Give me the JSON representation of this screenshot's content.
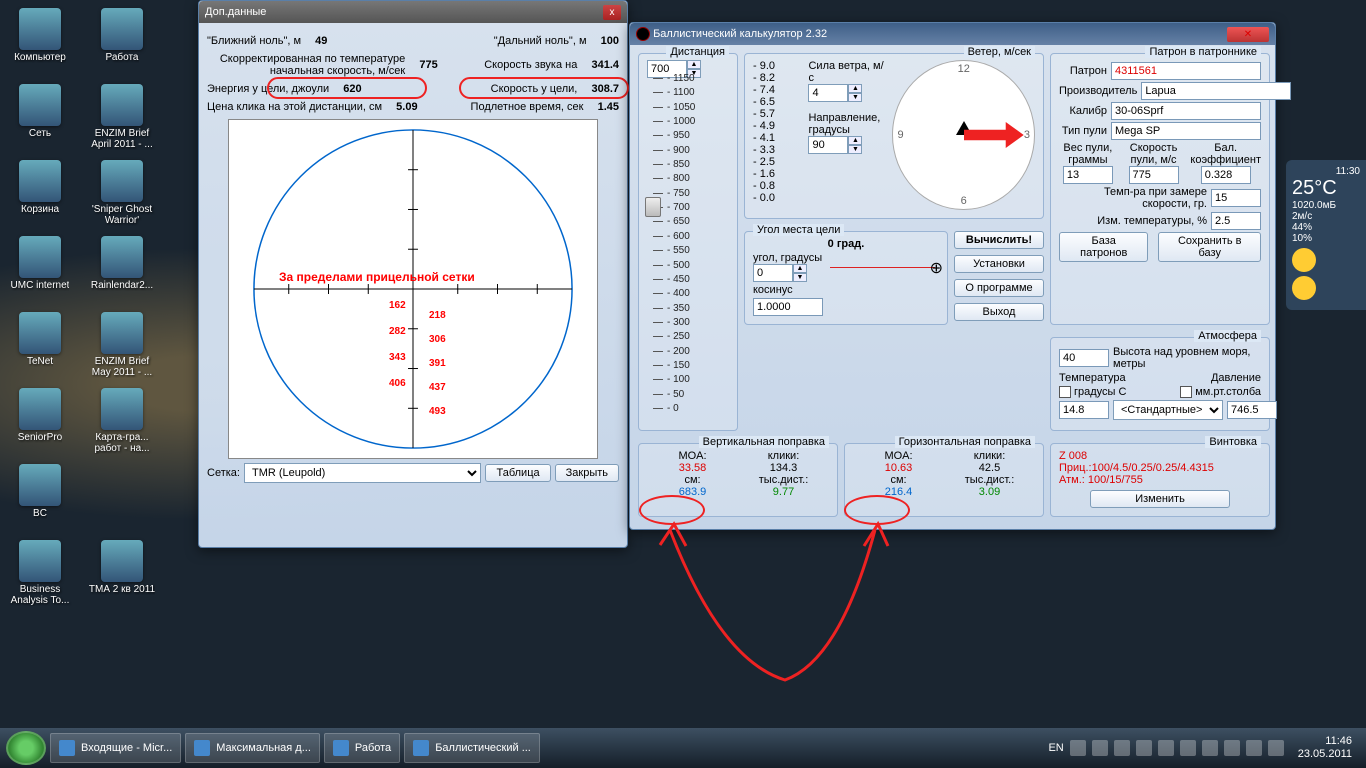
{
  "desktop_icons": [
    [
      "Компьютер",
      "Работа"
    ],
    [
      "Сеть",
      "ENZIM Brief April 2011 - ..."
    ],
    [
      "Корзина",
      "'Sniper Ghost Warrior'"
    ],
    [
      "UMC internet",
      "Rainlendar2..."
    ],
    [
      "TeNet",
      "ENZIM Brief May 2011 - ..."
    ],
    [
      "SeniorPro",
      "Карта-гра... работ - на..."
    ],
    [
      "BC",
      ""
    ],
    [
      "Business Analysis To...",
      "ТМА 2 кв 2011"
    ]
  ],
  "win1": {
    "title": "Доп.данные",
    "near_zero_lbl": "\"Ближний ноль\", м",
    "near_zero_val": "49",
    "far_zero_lbl": "\"Дальний ноль\", м",
    "far_zero_val": "100",
    "v_corr_lbl": "Скорректированная по температуре начальная скорость, м/сек",
    "v_corr_val": "775",
    "sound_lbl": "Скорость звука на",
    "sound_val": "341.4",
    "energy_lbl": "Энергия у цели, джоули",
    "energy_val": "620",
    "v_target_lbl": "Скорость у цели,",
    "v_target_val": "308.7",
    "click_lbl": "Цена клика на этой дистанции, см",
    "click_val": "5.09",
    "tof_lbl": "Подлетное время, сек",
    "tof_val": "1.45",
    "scope_warn": "За пределами прицельной сетки",
    "scope_nums_left": [
      "162",
      "282",
      "343",
      "406"
    ],
    "scope_nums_right": [
      "218",
      "306",
      "391",
      "437",
      "493"
    ],
    "grid_lbl": "Сетка:",
    "grid_val": "TMR (Leupold)",
    "btn_table": "Таблица",
    "btn_close": "Закрыть"
  },
  "win2": {
    "title": "Баллистический калькулятор 2.32",
    "group_dist": "Дистанция",
    "dist_val": "700",
    "dist_ticks": [
      "1150",
      "1100",
      "1050",
      "1000",
      "950",
      "900",
      "850",
      "800",
      "750",
      "700",
      "650",
      "600",
      "550",
      "500",
      "450",
      "400",
      "350",
      "300",
      "250",
      "200",
      "150",
      "100",
      "50",
      "0"
    ],
    "group_wind": "Ветер, м/сек",
    "wind_force_lbl": "Сила ветра, м/с",
    "wind_force_val": "4",
    "wind_dir_lbl": "Направление, градусы",
    "wind_dir_val": "90",
    "wind_ticks": [
      "9.0",
      "8.2",
      "7.4",
      "6.5",
      "5.7",
      "4.9",
      "4.1",
      "3.3",
      "2.5",
      "1.6",
      "0.8",
      "0.0"
    ],
    "compass": [
      "12",
      "3",
      "6",
      "9"
    ],
    "group_angle": "Угол места цели",
    "angle_txt": "0 град.",
    "angle_lbl": "угол, градусы",
    "angle_val": "0",
    "cos_lbl": "косинус",
    "cos_val": "1.0000",
    "btn_calc": "Вычислить!",
    "btn_settings": "Установки",
    "btn_about": "О программе",
    "btn_exit": "Выход",
    "group_cart": "Патрон в патроннике",
    "cart_patron_lbl": "Патрон",
    "cart_patron_val": "4311561",
    "cart_maker_lbl": "Производитель",
    "cart_maker_val": "Lapua",
    "cart_cal_lbl": "Калибр",
    "cart_cal_val": "30-06Sprf",
    "cart_type_lbl": "Тип пули",
    "cart_type_val": "Mega SP",
    "bw_lbl": "Вес пули, граммы",
    "bw_val": "13",
    "bv_lbl": "Скорость пули, м/с",
    "bv_val": "775",
    "bc_lbl": "Бал. коэффициент",
    "bc_val": "0.328",
    "tmeas_lbl": "Темп-ра при замере скорости, гр.",
    "tmeas_val": "15",
    "tdelta_lbl": "Изм. температуры, %",
    "tdelta_val": "2.5",
    "btn_db": "База патронов",
    "btn_save": "Сохранить в базу",
    "group_atm": "Атмосфера",
    "alt_val": "40",
    "alt_lbl": "Высота над уровнем моря, метры",
    "temp_hdr": "Температура",
    "press_hdr": "Давление",
    "temp_chk": "градусы С",
    "press_chk": "мм.рт.столба",
    "temp_val": "14.8",
    "std_val": "<Стандартные>",
    "press_val": "746.5",
    "group_vert": "Вертикальная поправка",
    "group_horz": "Горизонтальная поправка",
    "moa_lbl": "MOA:",
    "clicks_lbl": "клики:",
    "cm_lbl": "см:",
    "mil_lbl": "тыс.дист.:",
    "v_moa": "33.58",
    "v_click": "134.3",
    "v_cm": "683.9",
    "v_mil": "9.77",
    "h_moa": "10.63",
    "h_click": "42.5",
    "h_cm": "216.4",
    "h_mil": "3.09",
    "group_rifle": "Винтовка",
    "rifle_line1": "Z 008",
    "rifle_line2": "Приц.:100/4.5/0.25/0.25/4.4315",
    "rifle_line3": "Атм.: 100/15/755",
    "btn_change": "Изменить"
  },
  "gadget": {
    "time": "11:30",
    "temp": "25°C",
    "p": "1020.0мБ",
    "w": "2м/с",
    "h": "44%",
    "r": "10%"
  },
  "taskbar": {
    "tasks": [
      "Входящие - Micr...",
      "Максимальная д...",
      "Работа",
      "Баллистический ..."
    ],
    "lang": "EN",
    "clock_time": "11:46",
    "clock_date": "23.05.2011"
  }
}
